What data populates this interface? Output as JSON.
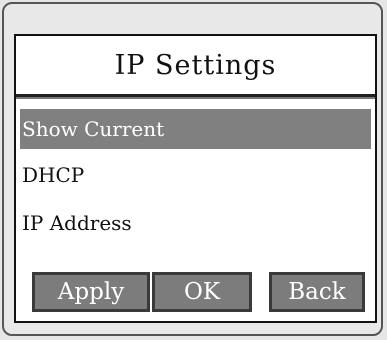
{
  "title": "IP Settings",
  "menu": {
    "items": [
      {
        "label": "Show Current",
        "selected": true
      },
      {
        "label": "DHCP",
        "selected": false
      },
      {
        "label": "IP Address",
        "selected": false
      }
    ]
  },
  "buttons": {
    "apply": "Apply",
    "ok": "OK",
    "back": "Back"
  },
  "colors": {
    "selection": "#808080",
    "button": "#7c7c7c",
    "screen": "#ffffff",
    "frame": "#e8e8e8"
  }
}
